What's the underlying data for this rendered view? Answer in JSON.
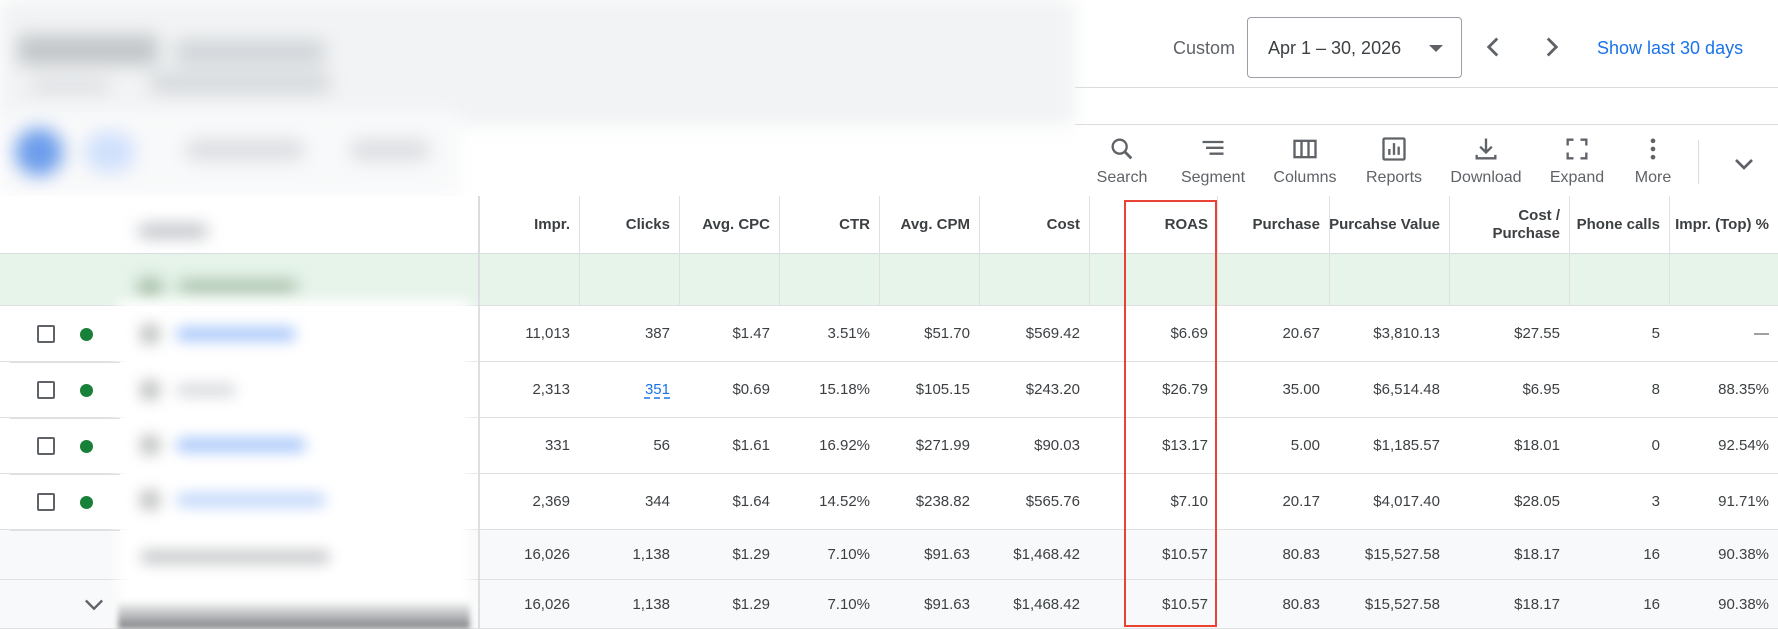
{
  "header": {
    "date_label": "Custom",
    "date_range": "Apr 1 – 30, 2026",
    "show_last": "Show last 30 days"
  },
  "toolbar": {
    "items": [
      {
        "label": "Search",
        "icon": "search-icon"
      },
      {
        "label": "Segment",
        "icon": "segment-icon"
      },
      {
        "label": "Columns",
        "icon": "columns-icon"
      },
      {
        "label": "Reports",
        "icon": "reports-icon"
      },
      {
        "label": "Download",
        "icon": "download-icon"
      },
      {
        "label": "Expand",
        "icon": "expand-icon"
      },
      {
        "label": "More",
        "icon": "more-vert-icon"
      }
    ]
  },
  "table": {
    "columns": [
      "Impr.",
      "Clicks",
      "Avg. CPC",
      "CTR",
      "Avg. CPM",
      "Cost",
      "ROAS",
      "Purchase",
      "Purcahse Value",
      "Cost / Purchase",
      "Phone calls",
      "Impr. (Top) %"
    ],
    "rows": [
      [
        "11,013",
        "387",
        "$1.47",
        "3.51%",
        "$51.70",
        "$569.42",
        "$6.69",
        "20.67",
        "$3,810.13",
        "$27.55",
        "5",
        "—"
      ],
      [
        "2,313",
        "351",
        "$0.69",
        "15.18%",
        "$105.15",
        "$243.20",
        "$26.79",
        "35.00",
        "$6,514.48",
        "$6.95",
        "8",
        "88.35%"
      ],
      [
        "331",
        "56",
        "$1.61",
        "16.92%",
        "$271.99",
        "$90.03",
        "$13.17",
        "5.00",
        "$1,185.57",
        "$18.01",
        "0",
        "92.54%"
      ],
      [
        "2,369",
        "344",
        "$1.64",
        "14.52%",
        "$238.82",
        "$565.76",
        "$7.10",
        "20.17",
        "$4,017.40",
        "$28.05",
        "3",
        "91.71%"
      ]
    ],
    "totals": [
      [
        "16,026",
        "1,138",
        "$1.29",
        "7.10%",
        "$91.63",
        "$1,468.42",
        "$10.57",
        "80.83",
        "$15,527.58",
        "$18.17",
        "16",
        "90.38%"
      ],
      [
        "16,026",
        "1,138",
        "$1.29",
        "7.10%",
        "$91.63",
        "$1,468.42",
        "$10.57",
        "80.83",
        "$15,527.58",
        "$18.17",
        "16",
        "90.38%"
      ]
    ]
  },
  "colors": {
    "accent": "#1a73e8",
    "status_enabled": "#188038",
    "highlight_box": "#ea4335",
    "summary_row": "#e6f4ea"
  }
}
